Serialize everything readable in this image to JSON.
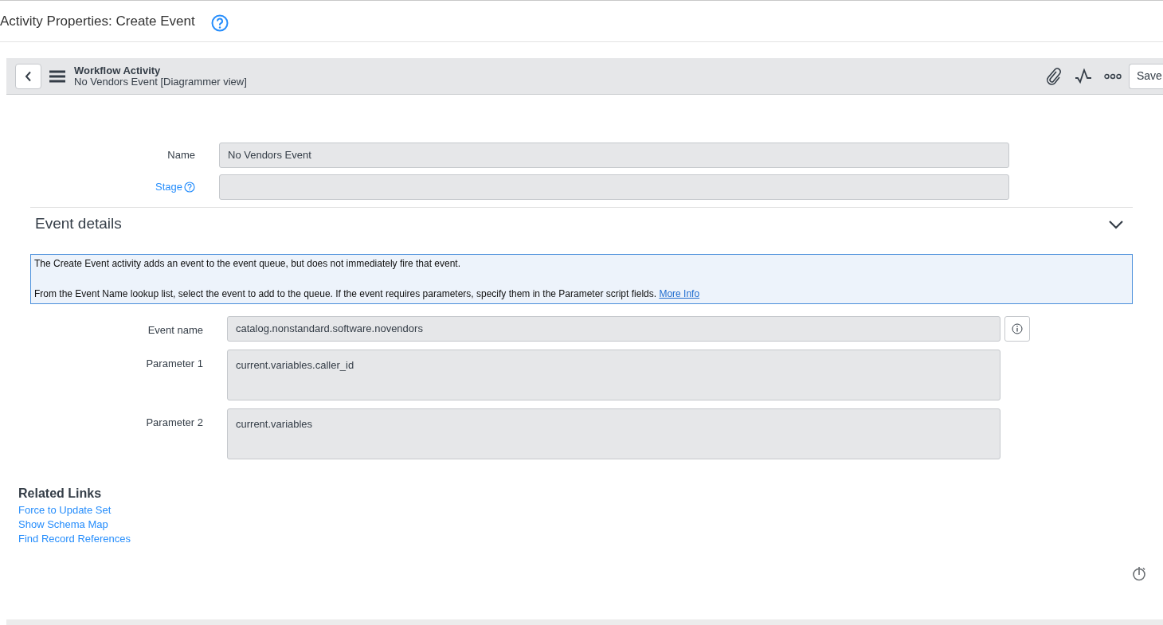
{
  "page_title": "Activity Properties: Create Event",
  "header": {
    "title": "Workflow Activity",
    "subtitle": "No Vendors Event [Diagrammer view]",
    "save": "Save"
  },
  "fields": [
    {
      "label": "Name",
      "value": "No Vendors Event",
      "has_help": false
    },
    {
      "label": "Stage",
      "has_help": true
    }
  ],
  "section": {
    "title": "Event details",
    "expanded": true
  },
  "info": {
    "lines": [
      "The Create Event activity adds an event to the event queue, but does not immediately fire that event.",
      "From the Event Name lookup list, select the event to add to the queue. If the event requires parameters, specify them in the Parameter script fields."
    ],
    "link": "More Info"
  },
  "event_fields": [
    {
      "kind": "reference",
      "label": "Event name",
      "value": "catalog.nonstandard.software.novendors"
    },
    {
      "kind": "script",
      "label": "Parameter 1",
      "value": "current.variables.caller_id"
    },
    {
      "kind": "script",
      "label": "Parameter 2",
      "value": "current.variables"
    }
  ],
  "related_links": {
    "title": "Related Links",
    "links": [
      "Force to Update Set",
      "Show Schema Map",
      "Find Record References"
    ]
  }
}
